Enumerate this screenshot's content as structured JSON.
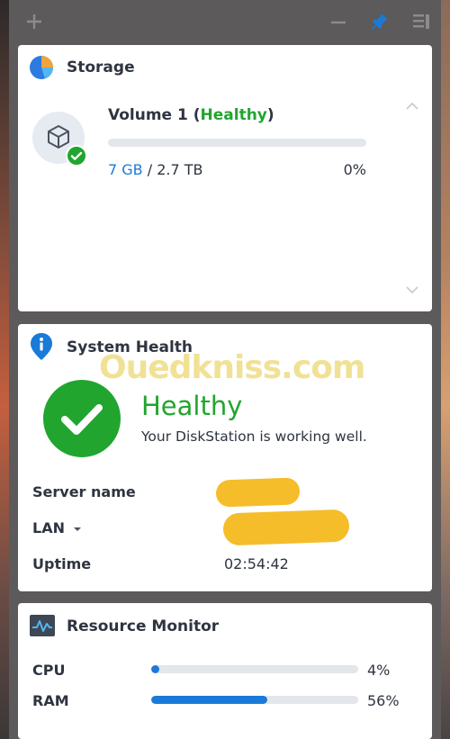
{
  "colors": {
    "accent": "#1a7ad8",
    "healthy": "#21a52f",
    "marker": "#f5bd2a"
  },
  "toolbar": {
    "add_icon": "plus-icon",
    "minimize_icon": "minus-icon",
    "pin_icon": "pin-icon",
    "layout_icon": "panel-layout-icon"
  },
  "storage": {
    "title": "Storage",
    "volume_name": "Volume 1 (",
    "volume_status": "Healthy",
    "volume_close": ")",
    "used": "7 GB",
    "separator": " / ",
    "total": "2.7 TB",
    "percent_label": "0%",
    "percent": 0
  },
  "system_health": {
    "title": "System Health",
    "status": "Healthy",
    "message": "Your DiskStation is working well.",
    "server_name_label": "Server name",
    "lan_label": "LAN",
    "uptime_label": "Uptime",
    "uptime": "02:54:42"
  },
  "resource_monitor": {
    "title": "Resource Monitor",
    "cpu_label": "CPU",
    "cpu_percent_label": "4%",
    "cpu_percent": 4,
    "ram_label": "RAM",
    "ram_percent_label": "56%",
    "ram_percent": 56
  },
  "watermark": "Ouedkniss.com"
}
